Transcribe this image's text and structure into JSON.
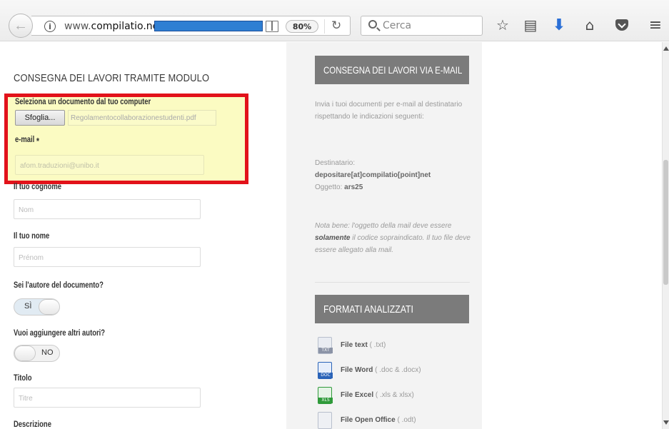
{
  "browser": {
    "url_prefix": "www.",
    "url_domain": "compilatio.net",
    "zoom": "80%",
    "search_placeholder": "Cerca"
  },
  "form": {
    "title": "CONSEGNA DEI LAVORI TRAMITE MODULO",
    "file_label": "Seleziona un documento dal tuo computer",
    "browse_label": "Sfoglia...",
    "file_name": "Regolamentocollaborazionestudenti.pdf",
    "email_label": "e-mail",
    "required_mark": "*",
    "email_value": "afom.traduzioni@unibo.it",
    "surname_label": "Il tuo cognome",
    "surname_placeholder": "Nom",
    "name_label": "Il tuo nome",
    "name_placeholder": "Prénom",
    "author_label": "Sei l'autore del documento?",
    "author_toggle": "SÌ",
    "coauthors_label": "Vuoi aggiungere altri autori?",
    "coauthors_toggle": "NO",
    "title_label": "Titolo",
    "title_placeholder": "Titre",
    "description_label": "Descrizione"
  },
  "email_panel": {
    "header": "CONSEGNA DEI LAVORI VIA E-MAIL",
    "intro": "Invia i tuoi documenti per e-mail al destinatario rispettando le indicazioni seguenti:",
    "recipient_label": "Destinatario:",
    "recipient_value": "depositare[at]compilatio[point]net",
    "subject_label": "Oggetto:",
    "subject_value": "ars25",
    "note_prefix": "Nota bene: l'oggetto della mail deve essere ",
    "note_bold": "solamente",
    "note_suffix": " il codice sopraindicato. Il tuo file deve essere allegato alla mail."
  },
  "formats_panel": {
    "header": "FORMATI ANALIZZATI",
    "items": [
      {
        "name": "File text",
        "ext": "( .txt)",
        "tag": "TXT",
        "color": "#9aa3b5"
      },
      {
        "name": "File Word",
        "ext": "( .doc & .docx)",
        "tag": "DOC",
        "color": "#2a63b8"
      },
      {
        "name": "File Excel",
        "ext": "( .xls & xlsx)",
        "tag": "XLS",
        "color": "#2f9a3a"
      },
      {
        "name": "File Open Office",
        "ext": "( .odt)",
        "tag": "",
        "color": "#9aa3b5"
      }
    ]
  },
  "colors": {
    "highlight_border": "#e2121a",
    "highlight_fill": "#fbfbc2",
    "panel_header": "#7b7b7b",
    "redaction": "#2f7fd3"
  }
}
